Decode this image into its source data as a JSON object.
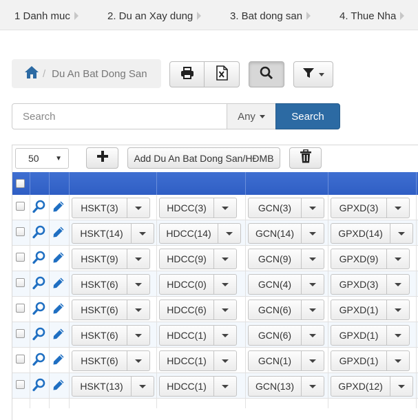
{
  "top_tabs": [
    "1 Danh muc",
    "2. Du an Xay dung",
    "3. Bat dong san",
    "4. Thue Nha"
  ],
  "breadcrumb": {
    "home_icon": "home-icon",
    "label": "Du An Bat Dong San"
  },
  "toolbar": {
    "print_icon": "print-icon",
    "excel_icon": "excel-icon",
    "search_icon": "search-icon",
    "filter_icon": "filter-icon"
  },
  "search": {
    "placeholder": "Search",
    "scope": "Any",
    "button": "Search"
  },
  "table_toolbar": {
    "page_size": "50",
    "add_label": "Add Du An Bat Dong San/HĐMB"
  },
  "rows": [
    [
      "HSKT(3)",
      "HDCC(3)",
      "GCN(3)",
      "GPXD(3)"
    ],
    [
      "HSKT(14)",
      "HDCC(14)",
      "GCN(14)",
      "GPXD(14)"
    ],
    [
      "HSKT(9)",
      "HDCC(9)",
      "GCN(9)",
      "GPXD(9)"
    ],
    [
      "HSKT(6)",
      "HDCC(0)",
      "GCN(4)",
      "GPXD(3)"
    ],
    [
      "HSKT(6)",
      "HDCC(6)",
      "GCN(6)",
      "GPXD(1)"
    ],
    [
      "HSKT(6)",
      "HDCC(1)",
      "GCN(6)",
      "GPXD(1)"
    ],
    [
      "HSKT(6)",
      "HDCC(1)",
      "GCN(1)",
      "GPXD(1)"
    ],
    [
      "HSKT(13)",
      "HDCC(1)",
      "GCN(13)",
      "GPXD(12)"
    ]
  ],
  "colors": {
    "header": "#2f5ec4",
    "primary_button": "#2c6aa3",
    "icon_blue": "#1f6fc2"
  }
}
